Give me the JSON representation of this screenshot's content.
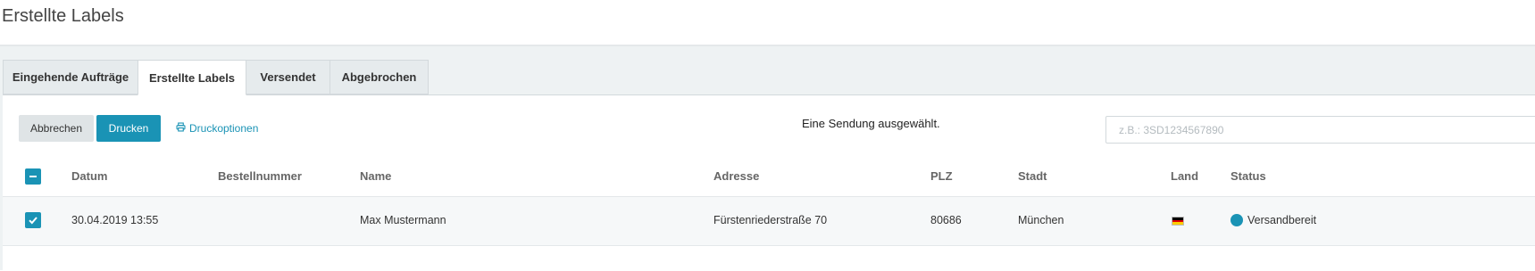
{
  "header": {
    "title": "Erstellte Labels"
  },
  "tabs": [
    {
      "label": "Eingehende Aufträge",
      "active": false
    },
    {
      "label": "Erstellte Labels",
      "active": true
    },
    {
      "label": "Versendet",
      "active": false
    },
    {
      "label": "Abgebrochen",
      "active": false
    }
  ],
  "toolbar": {
    "cancel_label": "Abbrechen",
    "print_label": "Drucken",
    "print_options_label": "Druckoptionen",
    "selection_info": "Eine Sendung ausgewählt.",
    "search_placeholder": "z.B.: 3SD1234567890",
    "search_value": ""
  },
  "table": {
    "columns": [
      "Datum",
      "Bestellnummer",
      "Name",
      "Adresse",
      "PLZ",
      "Stadt",
      "Land",
      "Status"
    ],
    "rows": [
      {
        "checked": true,
        "datum": "30.04.2019 13:55",
        "bestellnummer": "",
        "name": "Max Mustermann",
        "adresse": "Fürstenriederstraße 70",
        "plz": "80686",
        "stadt": "München",
        "land_icon": "germany-flag-icon",
        "status": "Versandbereit",
        "status_color": "#1a93b5"
      }
    ]
  },
  "colors": {
    "accent": "#1a93b5",
    "background": "#eef2f3"
  }
}
